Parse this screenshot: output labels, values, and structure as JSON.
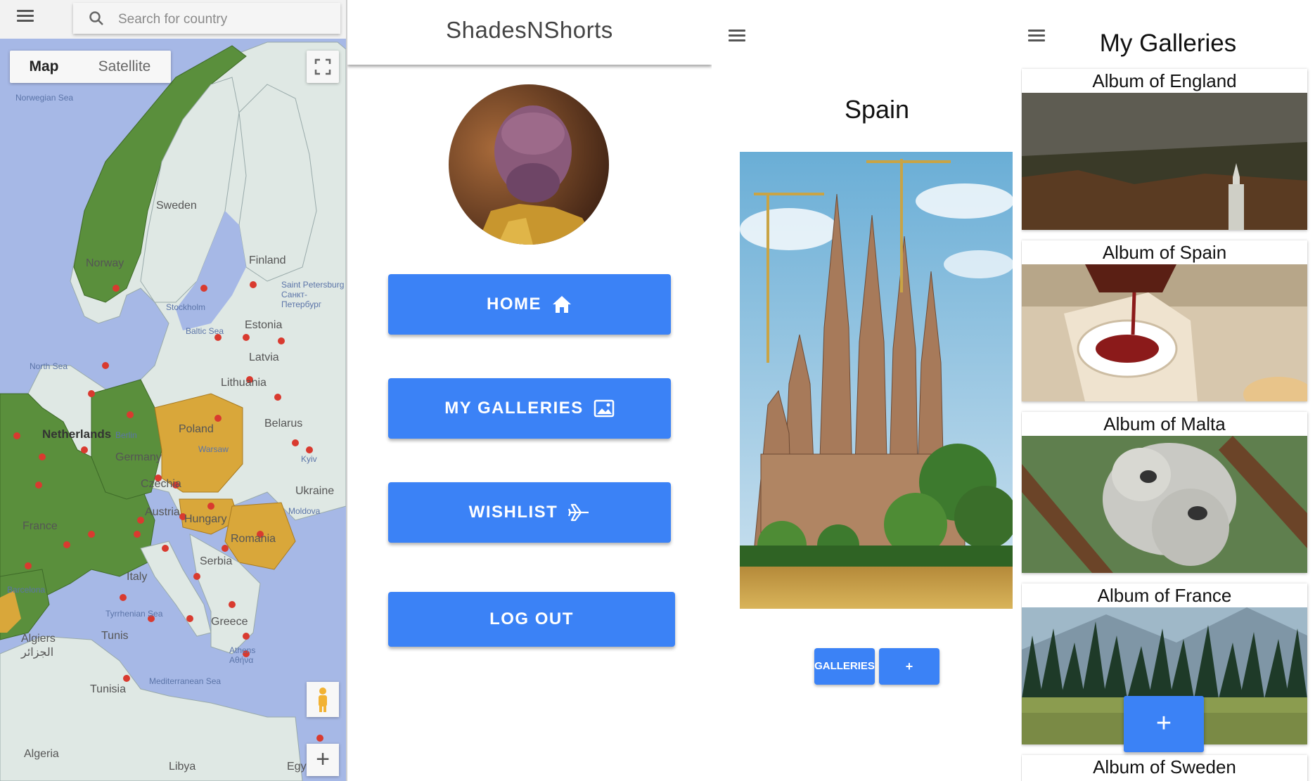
{
  "map_panel": {
    "search_placeholder": "Search for country",
    "map_type": {
      "map_label": "Map",
      "satellite_label": "Satellite"
    },
    "zoom_in_label": "+",
    "labels": {
      "norwegian_sea": "Norwegian Sea",
      "sweden": "Sweden",
      "finland": "Finland",
      "norway": "Norway",
      "st_petersburg": "Saint Petersburg Санкт-Петербург",
      "stockholm": "Stockholm",
      "estonia": "Estonia",
      "baltic_sea": "Baltic Sea",
      "latvia": "Latvia",
      "north_sea": "North Sea",
      "lithuania": "Lithuania",
      "belarus": "Belarus",
      "netherlands": "Netherlands",
      "berlin": "Berlin",
      "poland": "Poland",
      "warsaw": "Warsaw",
      "germany": "Germany",
      "kyiv": "Kyiv",
      "czechia": "Czechia",
      "ukraine": "Ukraine",
      "france": "France",
      "austria": "Austria",
      "hungary": "Hungary",
      "moldova": "Moldova",
      "romania": "Romania",
      "serbia": "Serbia",
      "italy": "Italy",
      "barcelona": "Barcelona",
      "tyrrhenian_sea": "Tyrrhenian Sea",
      "greece": "Greece",
      "algiers": "Algiers الجزائر",
      "tunis": "Tunis",
      "athens": "Athens Αθήνα",
      "tunisia": "Tunisia",
      "mediterranean_sea": "Mediterranean Sea",
      "algeria": "Algeria",
      "libya": "Libya",
      "egypt": "Egy"
    },
    "colors": {
      "water": "#a6b8e6",
      "land": "#dfe8e4",
      "visited": "#5a8f3c",
      "wishlist": "#d9a73a",
      "pin": "#d93a2f"
    }
  },
  "menu_panel": {
    "app_title": "ShadesNShorts",
    "buttons": [
      {
        "label": "HOME",
        "icon": "home-icon"
      },
      {
        "label": "MY GALLERIES",
        "icon": "image-icon"
      },
      {
        "label": "WISHLIST",
        "icon": "airplane-icon"
      },
      {
        "label": "LOG OUT",
        "icon": ""
      }
    ],
    "accent": "#3b82f6"
  },
  "country_panel": {
    "country": "Spain",
    "galleries_button": "GALLERIES",
    "add_button": "+"
  },
  "galleries_panel": {
    "title": "My Galleries",
    "albums": [
      {
        "label": "Album of England"
      },
      {
        "label": "Album of Spain"
      },
      {
        "label": "Album of Malta"
      },
      {
        "label": "Album of France"
      },
      {
        "label": "Album of Sweden"
      }
    ],
    "fab_label": "+"
  }
}
